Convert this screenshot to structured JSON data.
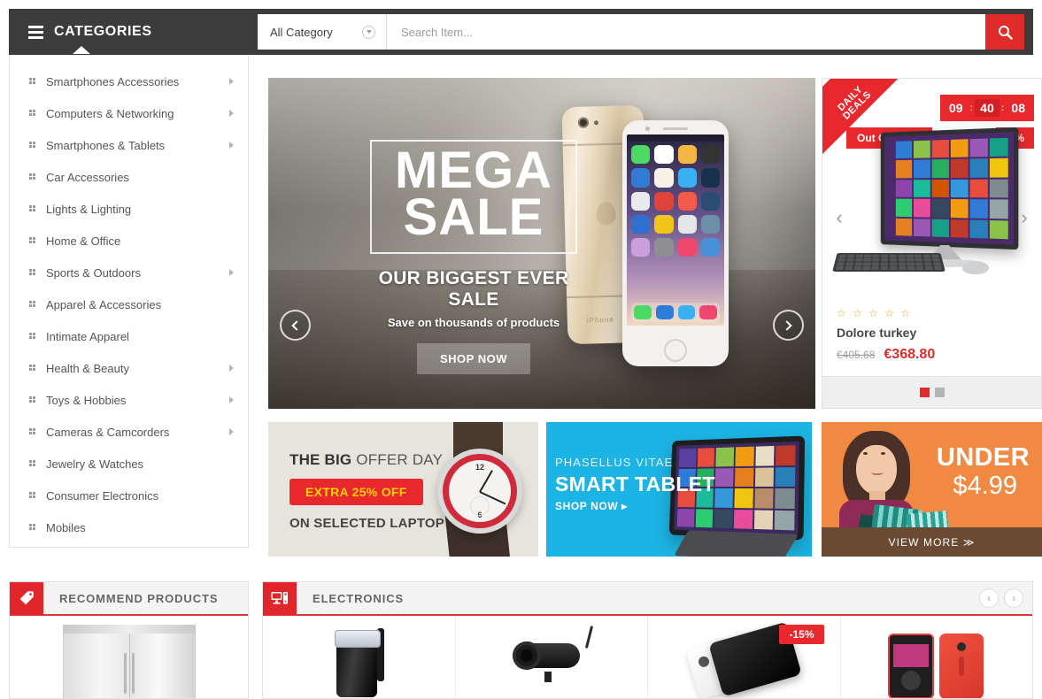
{
  "header": {
    "categories_label": "CATEGORIES",
    "categories_icon": "list-icon",
    "search": {
      "selected_category": "All Category",
      "placeholder": "Search Item...",
      "value": "",
      "button_icon": "search-icon"
    }
  },
  "sidebar": {
    "items": [
      {
        "label": "Smartphones Accessories",
        "has_submenu": true
      },
      {
        "label": "Computers & Networking",
        "has_submenu": true
      },
      {
        "label": "Smartphones & Tablets",
        "has_submenu": true
      },
      {
        "label": "Car Accessories",
        "has_submenu": false
      },
      {
        "label": "Lights & Lighting",
        "has_submenu": false
      },
      {
        "label": "Home & Office",
        "has_submenu": false
      },
      {
        "label": "Sports & Outdoors",
        "has_submenu": true
      },
      {
        "label": "Apparel & Accessories",
        "has_submenu": false
      },
      {
        "label": "Intimate Apparel",
        "has_submenu": false
      },
      {
        "label": "Health & Beauty",
        "has_submenu": true
      },
      {
        "label": "Toys & Hobbies",
        "has_submenu": true
      },
      {
        "label": "Cameras & Camcorders",
        "has_submenu": true
      },
      {
        "label": "Jewelry & Watches",
        "has_submenu": false
      },
      {
        "label": "Consumer Electronics",
        "has_submenu": false
      },
      {
        "label": "Mobiles",
        "has_submenu": false
      }
    ]
  },
  "hero": {
    "title_line1": "MEGA",
    "title_line2": "SALE",
    "subtitle": "OUR BIGGEST EVER SALE",
    "tagline": "Save on thousands of products",
    "cta": "SHOP NOW",
    "prev_icon": "chevron-left-icon",
    "next_icon": "chevron-right-icon"
  },
  "deals": {
    "ribbon_line1": "DAILY",
    "ribbon_line2": "DEALS",
    "timer": {
      "hours": "09",
      "minutes": "40",
      "seconds": "08",
      "separator": ":"
    },
    "stock_badge": "Out Of Stock",
    "discount_badge": "-9%",
    "rating_stars": "☆ ☆ ☆ ☆ ☆",
    "product_name": "Dolore turkey",
    "old_price": "€405.68",
    "new_price": "€368.80",
    "prev_icon": "chevron-left-icon",
    "next_icon": "chevron-right-icon",
    "pager": [
      {
        "state": "active"
      },
      {
        "state": "inactive"
      }
    ],
    "accent_color": "#e8282d"
  },
  "promos": [
    {
      "id": "big-offer-day",
      "title_bold": "THE BIG",
      "title_rest": " OFFER DAY",
      "badge": "EXTRA 25% OFF",
      "footer": "ON SELECTED LAPTOP",
      "bg_color": "#e7e4dc",
      "badge_bg": "#e8282d",
      "badge_color": "#ffd400"
    },
    {
      "id": "smart-tablet",
      "eyebrow": "PHASELLUS VITAE",
      "title": "SMART TABLET",
      "cta": "SHOP NOW ▸",
      "bg_color": "#1bb4e4"
    },
    {
      "id": "under-499",
      "title": "UNDER",
      "price": "$4.99",
      "cta": "VIEW MORE  ≫",
      "bg_color": "#f08a43",
      "bar_color": "#6a4a33"
    }
  ],
  "panels": {
    "recommend": {
      "title": "RECOMMEND PRODUCTS",
      "icon": "tag-icon",
      "products": [
        {
          "art": "fridge"
        }
      ]
    },
    "electronics": {
      "title": "ELECTRONICS",
      "icon": "monitor-icon",
      "prev_icon": "chevron-left-icon",
      "next_icon": "chevron-right-icon",
      "products": [
        {
          "art": "kettle",
          "badge": ""
        },
        {
          "art": "security-camera",
          "badge": ""
        },
        {
          "art": "smartphones-pair",
          "badge": "-15%"
        },
        {
          "art": "nokia-phones",
          "badge": ""
        }
      ]
    }
  },
  "colors": {
    "brand_red": "#e0252b",
    "dark_bar": "#3c3c3c",
    "price_red": "#e02b2b",
    "star_gold": "#e8a33d"
  }
}
